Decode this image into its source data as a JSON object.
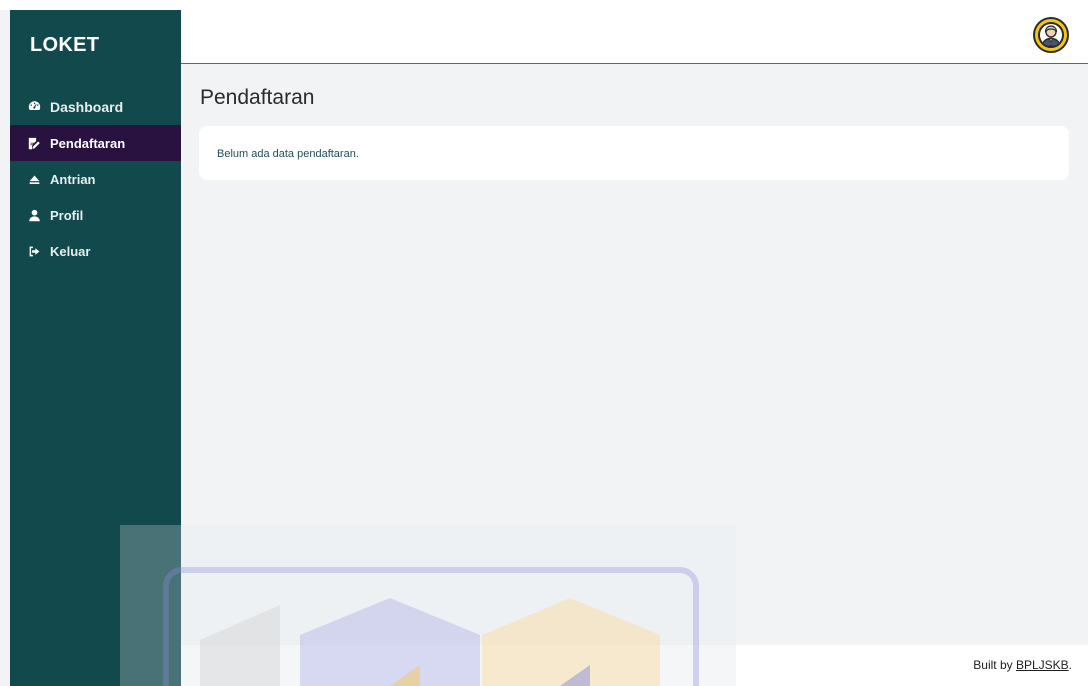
{
  "sidebar": {
    "brand": "LOKET",
    "items": [
      {
        "label": "Dashboard",
        "icon": "dashboard-icon",
        "active": false
      },
      {
        "label": "Pendaftaran",
        "icon": "edit-icon",
        "active": true
      },
      {
        "label": "Antrian",
        "icon": "eject-icon",
        "active": false
      },
      {
        "label": "Profil",
        "icon": "user-icon",
        "active": false
      },
      {
        "label": "Keluar",
        "icon": "sign-out-icon",
        "active": false
      }
    ]
  },
  "header": {
    "avatar_icon": "user-avatar-icon"
  },
  "main": {
    "title": "Pendaftaran",
    "empty_message": "Belum ada data pendaftaran."
  },
  "footer": {
    "prefix": "Built by ",
    "link": "BPLJSKB",
    "suffix": "."
  },
  "colors": {
    "sidebar_bg": "#12494c",
    "active_item_bg": "#29123f",
    "page_bg": "#f2f3f5",
    "avatar_ring": "#f4c518"
  }
}
